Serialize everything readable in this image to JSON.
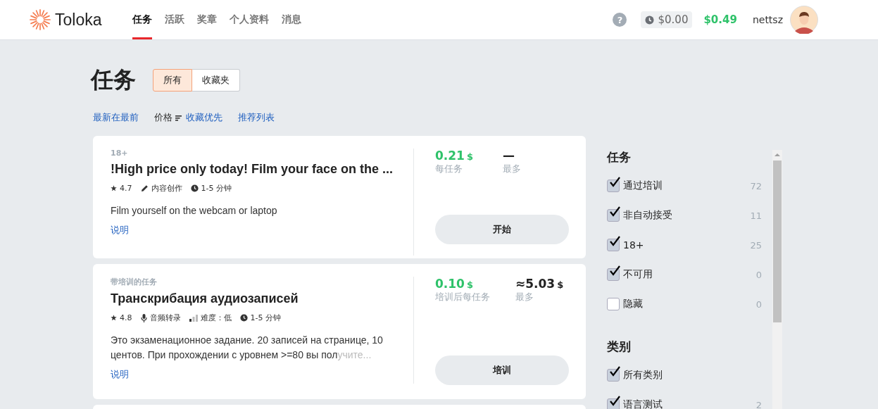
{
  "header": {
    "logo": "Toloka",
    "nav": [
      {
        "label": "任务",
        "selected": true
      },
      {
        "label": "活跃",
        "selected": false
      },
      {
        "label": "奖章",
        "selected": false
      },
      {
        "label": "个人资料",
        "selected": false
      },
      {
        "label": "消息",
        "selected": false
      }
    ],
    "help": "?",
    "pending": "$0.00",
    "balance": "$0.49",
    "username": "nettsz"
  },
  "page": {
    "title": "任务",
    "filters": [
      {
        "label": "所有",
        "selected": true
      },
      {
        "label": "收藏夹",
        "selected": false
      }
    ],
    "sorts": [
      {
        "label": "最新在最前",
        "kind": "link"
      },
      {
        "label": "价格",
        "kind": "sort"
      },
      {
        "label": "收藏优先",
        "kind": "link"
      },
      {
        "label": "推荐列表",
        "kind": "link"
      }
    ]
  },
  "tasks": [
    {
      "tag": "18+",
      "title": "!High price only today! Film your face on the ...",
      "rating": "4.7",
      "meta": [
        {
          "kind": "pencil",
          "text": "内容创作"
        },
        {
          "kind": "clock",
          "text": "1-5 分钟"
        }
      ],
      "description": "Film yourself on the webcam or laptop",
      "link": "说明",
      "price": "0.21",
      "currency": "$",
      "price_label": "每任务",
      "max": "—",
      "max_label": "最多",
      "button": "开始"
    },
    {
      "tag": "带培训的任务",
      "title": "Транскрибация аудиозаписей",
      "rating": "4.8",
      "meta": [
        {
          "kind": "mic",
          "text": "音频转录"
        },
        {
          "kind": "bars",
          "text": "难度：低"
        },
        {
          "kind": "clock",
          "text": "1-5 分钟"
        }
      ],
      "description": "Это экзаменационное задание. 20 записей на странице, 10 центов. При прохождении с уровнем >=80 вы пол",
      "faded_tail": "учите...",
      "link": "说明",
      "price": "0.10",
      "currency": "$",
      "price_label": "培训后每任务",
      "max": "≈5.03",
      "max_currency": "$",
      "max_label": "最多",
      "button": "培训"
    }
  ],
  "sidebar": [
    {
      "heading": "任务",
      "items": [
        {
          "label": "通过培训",
          "count": "72",
          "checked": true
        },
        {
          "label": "非自动接受",
          "count": "11",
          "checked": true
        },
        {
          "label": "18+",
          "count": "25",
          "checked": true
        },
        {
          "label": "不可用",
          "count": "0",
          "checked": true
        },
        {
          "label": "隐藏",
          "count": "0",
          "checked": false
        }
      ]
    },
    {
      "heading": "类别",
      "items": [
        {
          "label": "所有类别",
          "checked": true
        },
        {
          "label": "语言测试",
          "count": "2",
          "checked": true
        }
      ]
    }
  ]
}
